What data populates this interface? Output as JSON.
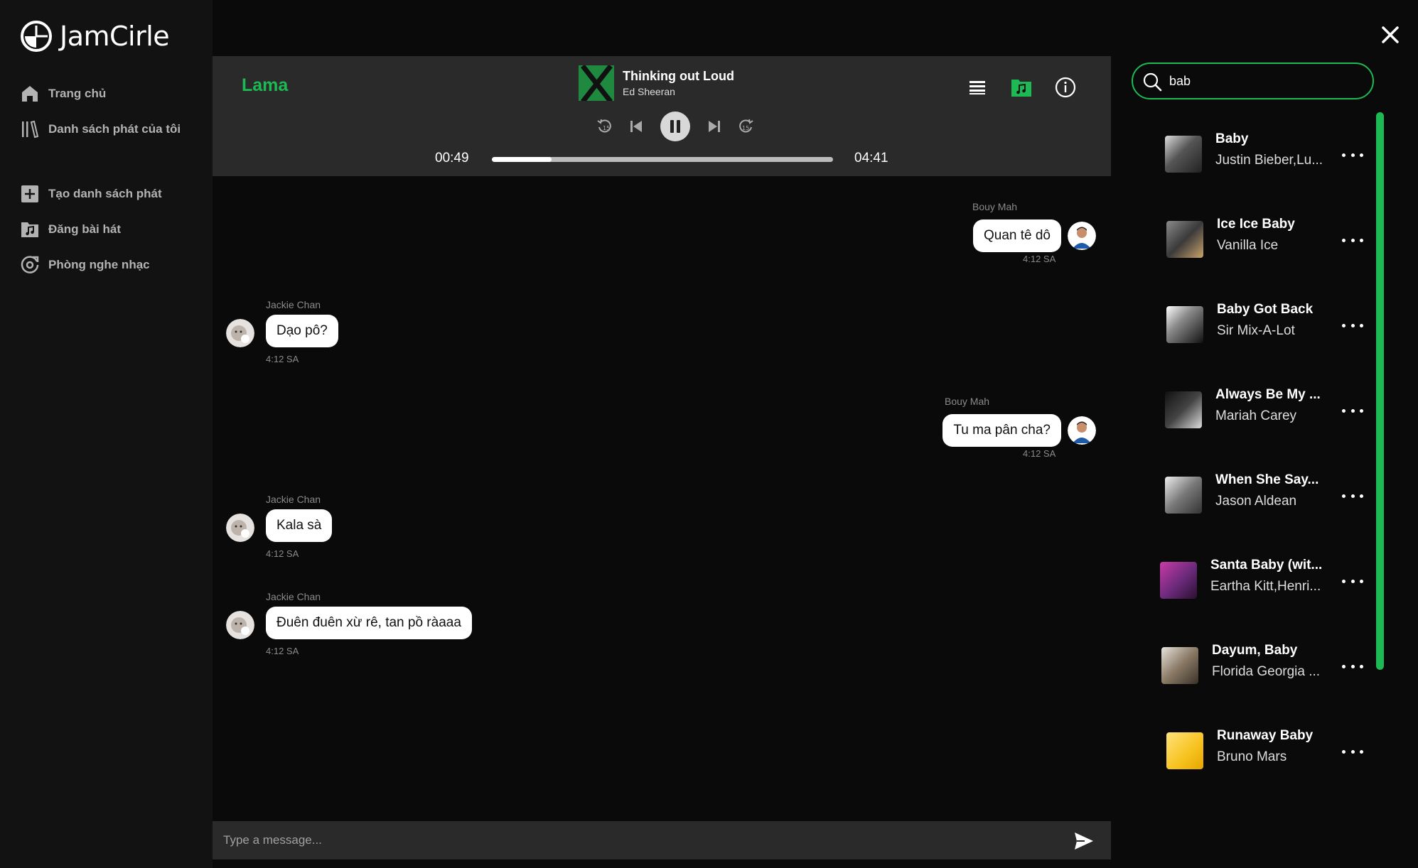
{
  "app": {
    "name": "JamCirle"
  },
  "sidebar": {
    "items": [
      {
        "label": "Trang chủ",
        "icon": "home-icon"
      },
      {
        "label": "Danh sách phát của tôi",
        "icon": "library-icon"
      },
      {
        "label": "Tạo danh sách phát",
        "icon": "add-box-icon"
      },
      {
        "label": "Đăng bài hát",
        "icon": "music-upload-icon"
      },
      {
        "label": "Phòng nghe nhạc",
        "icon": "listening-room-icon"
      }
    ]
  },
  "player": {
    "room": "Lama",
    "title": "Thinking out Loud",
    "artist": "Ed Sheeran",
    "current_time": "00:49",
    "total_time": "04:41",
    "progress": 0.174,
    "accent": "#1db954"
  },
  "messages": [
    {
      "sender": "Bouy Mah",
      "text": "Quan tê dô",
      "time": "4:12 SA",
      "side": "right"
    },
    {
      "sender": "Jackie Chan",
      "text": "Dạo pô?",
      "time": "4:12 SA",
      "side": "left"
    },
    {
      "sender": "Bouy Mah",
      "text": "Tu ma pân cha?",
      "time": "4:12 SA",
      "side": "right"
    },
    {
      "sender": "Jackie Chan",
      "text": "Kala sà",
      "time": "4:12 SA",
      "side": "left"
    },
    {
      "sender": "Jackie Chan",
      "text": "Đuên đuên xừ rê, tan pồ ràaaa",
      "time": "4:12 SA",
      "side": "left"
    }
  ],
  "composer": {
    "placeholder": "Type a message..."
  },
  "search": {
    "value": "bab",
    "results": [
      {
        "title": "Baby",
        "artist": "Justin Bieber,Lu..."
      },
      {
        "title": "Ice Ice Baby",
        "artist": "Vanilla Ice"
      },
      {
        "title": "Baby Got Back",
        "artist": "Sir Mix-A-Lot"
      },
      {
        "title": "Always Be My ...",
        "artist": "Mariah Carey"
      },
      {
        "title": "When She Say...",
        "artist": "Jason Aldean"
      },
      {
        "title": "Santa Baby (wit...",
        "artist": "Eartha Kitt,Henri..."
      },
      {
        "title": "Dayum, Baby",
        "artist": "Florida Georgia ..."
      },
      {
        "title": "Runaway Baby",
        "artist": "Bruno Mars"
      }
    ]
  }
}
